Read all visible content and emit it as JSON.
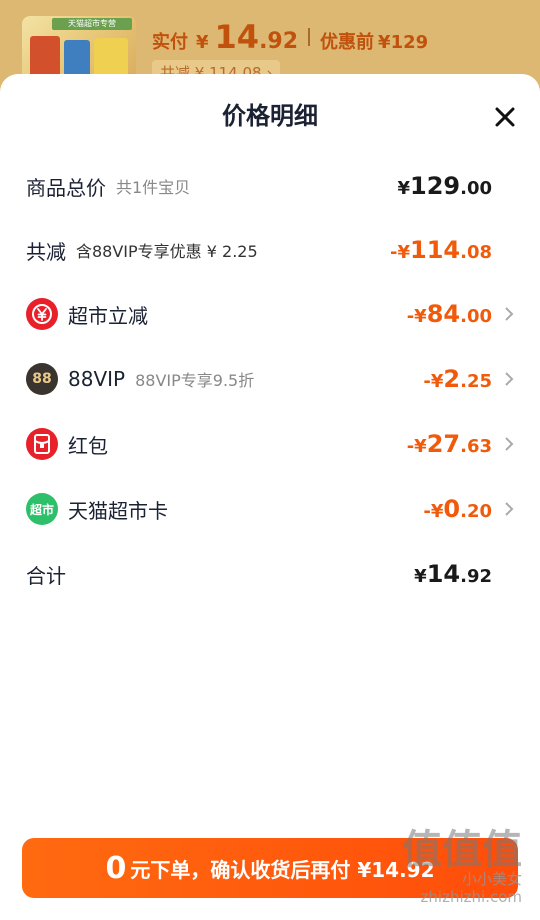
{
  "background": {
    "thumb_banner": "天猫超市专营",
    "price_label": "实付",
    "currency": "¥",
    "price_int": "14",
    "price_dec": ".92",
    "original_label": "优惠前",
    "original_price": "¥129",
    "saving_text": "共减 ¥ 114.08 ›"
  },
  "sheet": {
    "title": "价格明细",
    "close_icon": "close-icon"
  },
  "rows": {
    "total": {
      "name": "商品总价",
      "sub": "共1件宝贝",
      "cur": "¥",
      "int": "129",
      "dec": ".00"
    },
    "reduce": {
      "name": "共减",
      "sub": "含88VIP专享优惠 ¥ 2.25",
      "cur": "-¥",
      "int": "114",
      "dec": ".08"
    },
    "supermarket": {
      "name": "超市立减",
      "cur": "-¥",
      "int": "84",
      "dec": ".00",
      "icon": "discount-yen-icon"
    },
    "vip": {
      "name": "88VIP",
      "sub": "88VIP专享9.5折",
      "cur": "-¥",
      "int": "2",
      "dec": ".25",
      "icon_text": "88"
    },
    "redpacket": {
      "name": "红包",
      "cur": "-¥",
      "int": "27",
      "dec": ".63",
      "icon": "red-packet-icon"
    },
    "tmallcard": {
      "name": "天猫超市卡",
      "cur": "-¥",
      "int": "0",
      "dec": ".20",
      "icon_text": "超市"
    },
    "sum": {
      "name": "合计",
      "cur": "¥",
      "int": "14",
      "dec": ".92"
    }
  },
  "cta": {
    "zero": "0",
    "text": "元下单，确认收货后再付 ¥14.92"
  },
  "watermark": {
    "big": "值值值",
    "line1": "小小美女",
    "line2": "zhizhizhi.com"
  },
  "colors": {
    "accent_orange": "#f05a0a",
    "cta_orange": "#ff5a0c",
    "title_dark": "#1b2233"
  }
}
